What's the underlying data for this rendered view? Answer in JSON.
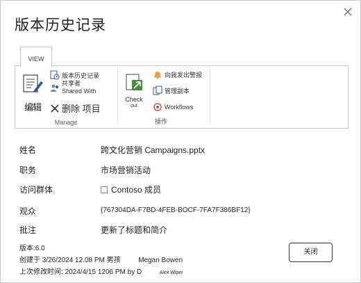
{
  "dialog": {
    "title": "版本历史记录"
  },
  "ribbon": {
    "tab_label": "VIEW",
    "manage": {
      "label": "Manage",
      "edit_label": "编辑",
      "version_history_label": "版本历史记录",
      "shared_with_label_1": "共享者",
      "shared_with_label_2": "Shared With",
      "delete_label": "删除 项目"
    },
    "actions": {
      "label": "操作",
      "checkout_label_1": "Check",
      "checkout_label_2": "out",
      "alert_label": "向我发出警报",
      "manage_copies_label": "管理副本",
      "workflows_label": "Workflows"
    }
  },
  "properties": [
    {
      "label": "姓名",
      "value": "跨文化营销 Campaigns.pptx"
    },
    {
      "label": "职务",
      "value": "市场营销活动"
    },
    {
      "label": "访问群体",
      "value": "Contoso 成员"
    },
    {
      "label": "观众",
      "value": "{767304DA-F7BD-4FEB-BOCF-7FA7F386BF12}"
    },
    {
      "label": "批注",
      "value": "更新了标题和简介"
    }
  ],
  "footer": {
    "version": "版本:6.0",
    "created_prefix": "创建于",
    "created_date": "3/26/2024  12.08 PM 男孩",
    "created_by": "Megan Bowen",
    "modified_prefix": "上次修改时间:",
    "modified_date": "2024/4/15 1206 PM by D",
    "modified_by": "Alex Wiper"
  },
  "buttons": {
    "close_label": "关闭"
  },
  "colors": {
    "accent_blue": "#2b579a",
    "alert_orange": "#e8a33c",
    "icon_green": "#4a8a3c"
  }
}
